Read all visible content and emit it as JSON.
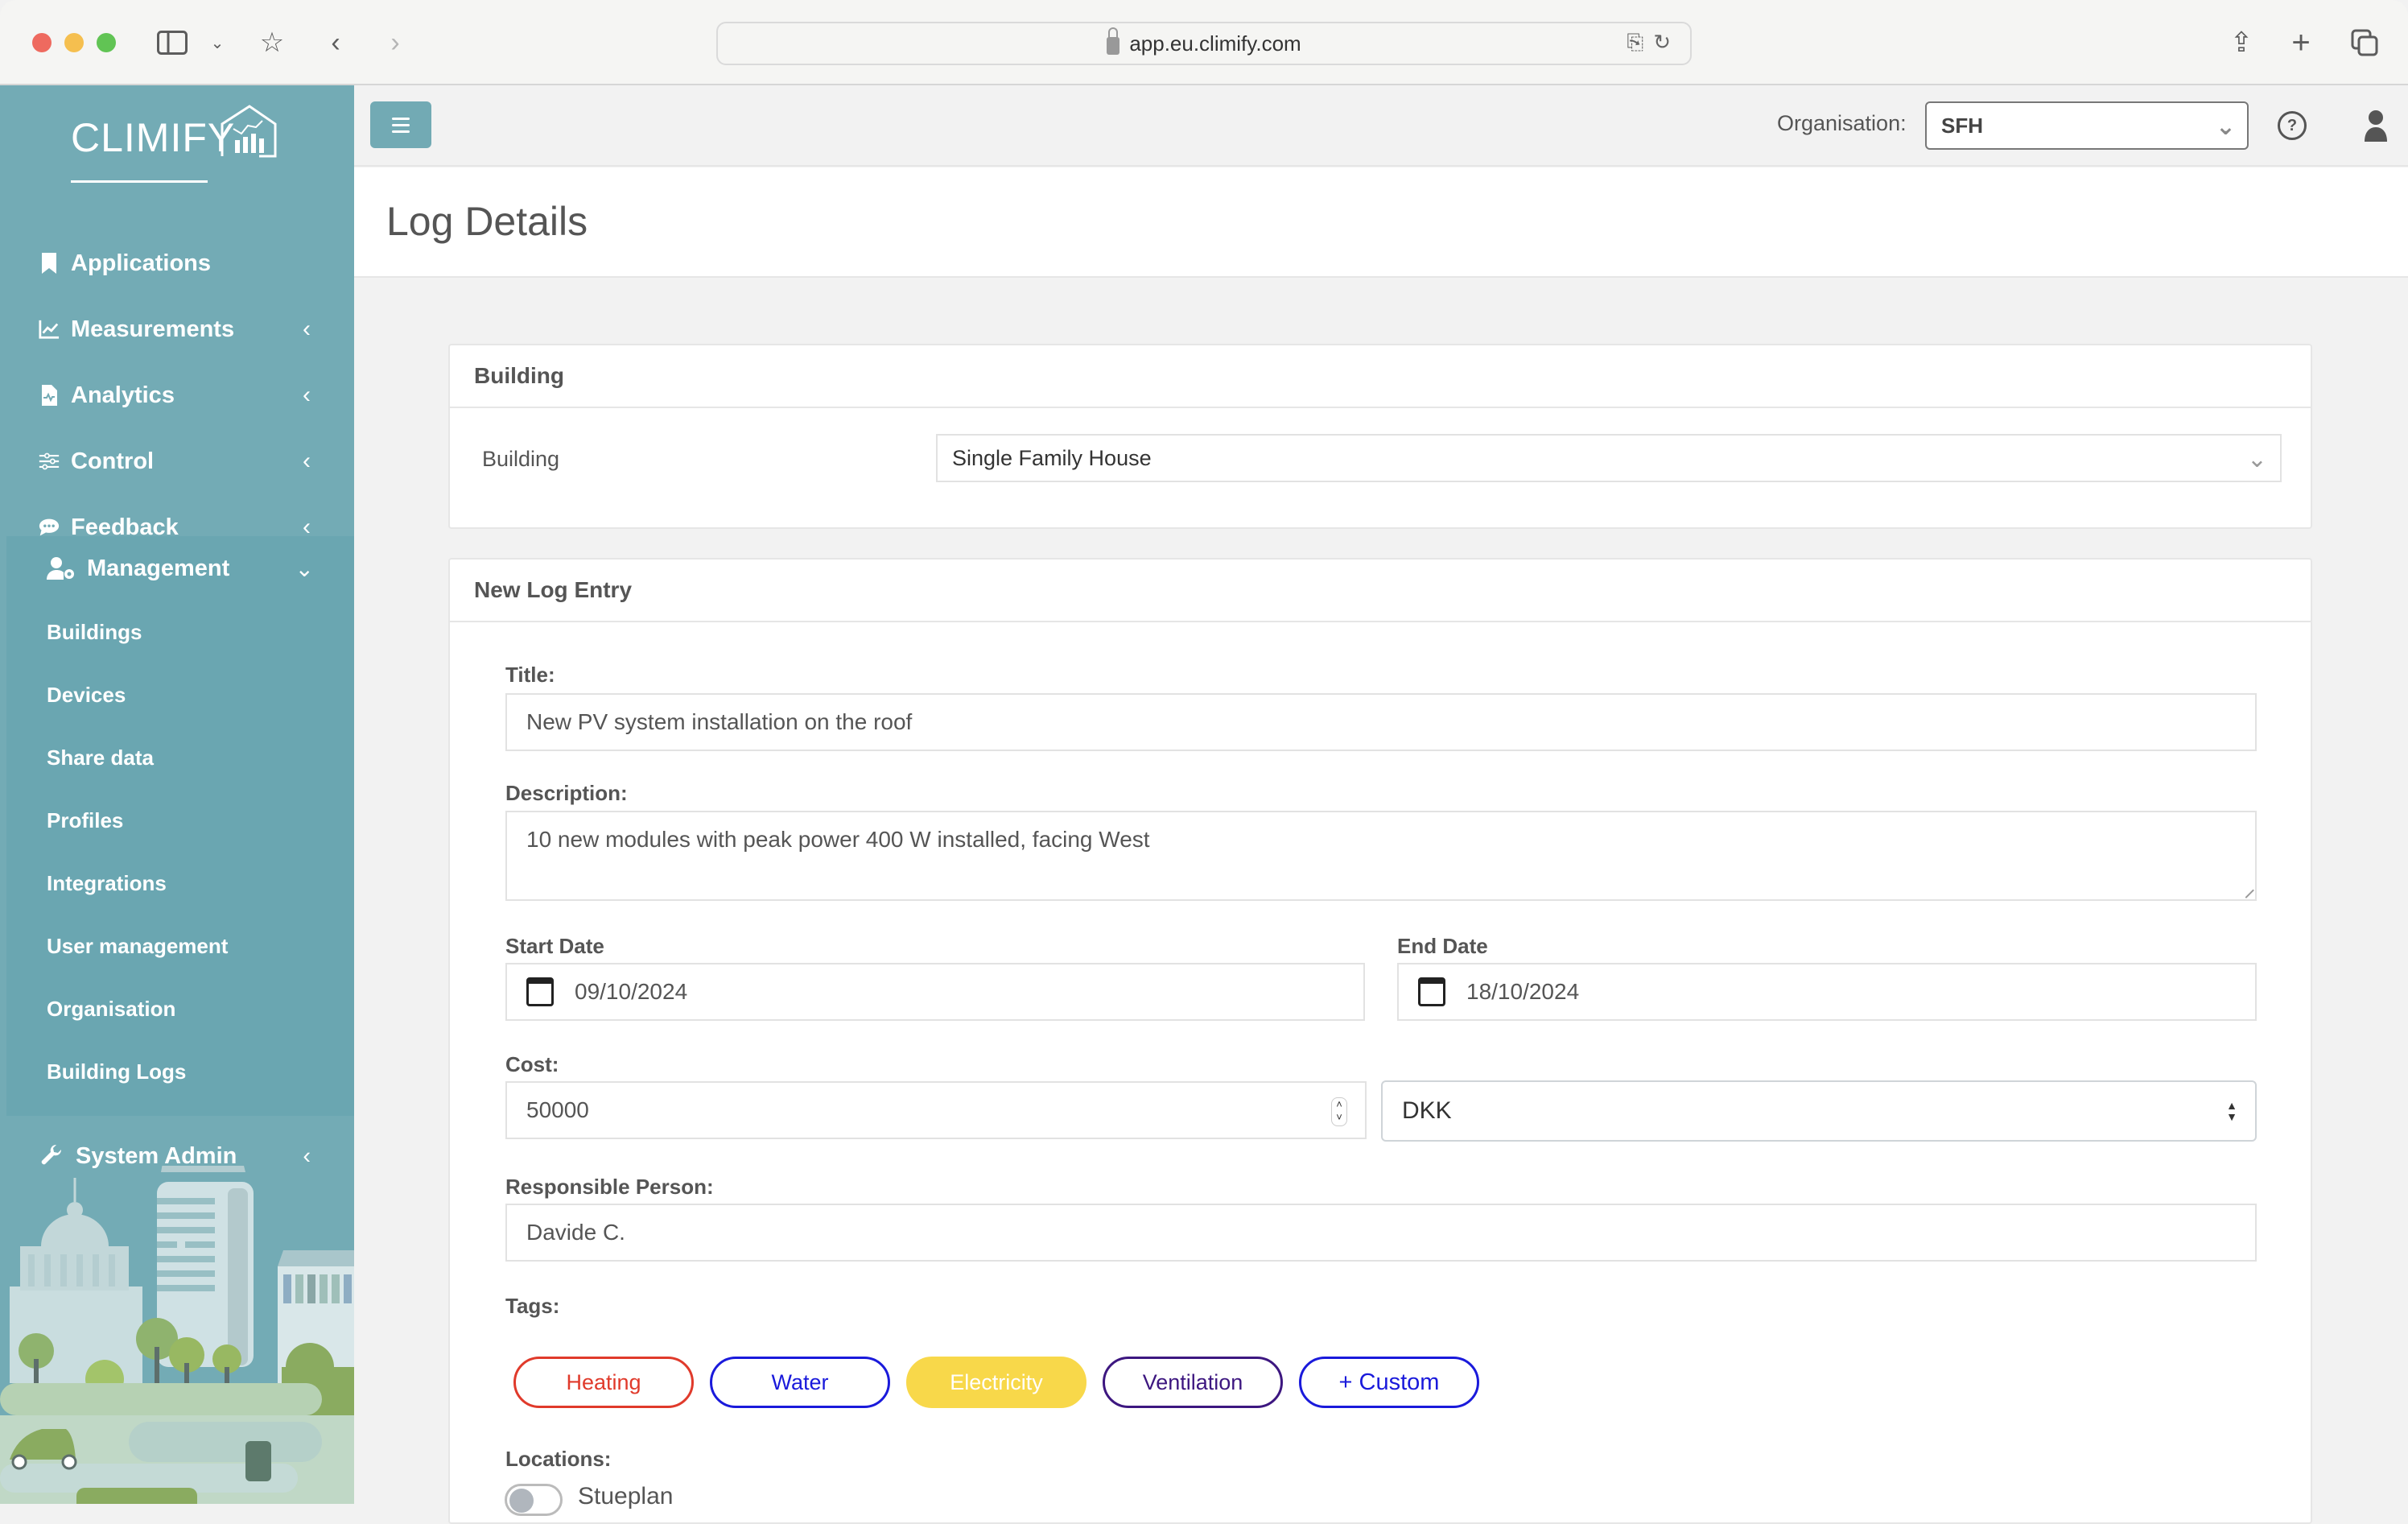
{
  "browser": {
    "url": "app.eu.climify.com",
    "icons": [
      "sidebar-toggle-icon",
      "chevron-down-icon",
      "bookmark-star-icon",
      "back-icon",
      "forward-icon",
      "translate-icon",
      "reload-icon",
      "share-icon",
      "new-tab-icon",
      "tabs-overview-icon"
    ]
  },
  "sidebar": {
    "logo": "CLIMIFY",
    "items": [
      {
        "label": "Applications",
        "icon": "bookmark-icon",
        "chevron": ""
      },
      {
        "label": "Measurements",
        "icon": "line-chart-icon",
        "chevron": "‹"
      },
      {
        "label": "Analytics",
        "icon": "file-medical-icon",
        "chevron": "‹"
      },
      {
        "label": "Control",
        "icon": "sliders-icon",
        "chevron": "‹"
      },
      {
        "label": "Feedback",
        "icon": "comment-dots-icon",
        "chevron": "‹"
      }
    ],
    "management": {
      "label": "Management",
      "icon": "user-gear-icon",
      "chevron": "⌄",
      "subitems": [
        "Buildings",
        "Devices",
        "Share data",
        "Profiles",
        "Integrations",
        "User management",
        "Organisation",
        "Building Logs"
      ]
    },
    "system_admin": {
      "label": "System Admin",
      "icon": "wrench-icon",
      "chevron": "‹"
    }
  },
  "topbar": {
    "org_label": "Organisation:",
    "org_value": "SFH",
    "help_icon": "?",
    "accent": "#72aab4"
  },
  "page": {
    "title": "Log Details"
  },
  "building_card": {
    "header": "Building",
    "label": "Building",
    "value": "Single Family House"
  },
  "log_card": {
    "header": "New Log Entry",
    "title_label": "Title:",
    "title_value": "New PV system installation on the roof",
    "description_label": "Description:",
    "description_value": "10 new modules with peak power 400 W installed, facing West",
    "start_label": "Start Date",
    "start_value": "09/10/2024",
    "end_label": "End Date",
    "end_value": "18/10/2024",
    "cost_label": "Cost:",
    "cost_value": "50000",
    "currency_value": "DKK",
    "person_label": "Responsible Person:",
    "person_value": "Davide C.",
    "tags_label": "Tags:",
    "tags": [
      {
        "label": "Heating",
        "color": "#e03a2b",
        "selected": false
      },
      {
        "label": "Water",
        "color": "#1a1adb",
        "selected": false
      },
      {
        "label": "Electricity",
        "color": "#f8d84a",
        "selected": true
      },
      {
        "label": "Ventilation",
        "color": "#3d1780",
        "selected": false
      },
      {
        "label": "+ Custom",
        "color": "#1a1adb",
        "selected": false
      }
    ],
    "locations_label": "Locations:",
    "locations": [
      {
        "label": "Stueplan",
        "enabled": false
      }
    ]
  }
}
